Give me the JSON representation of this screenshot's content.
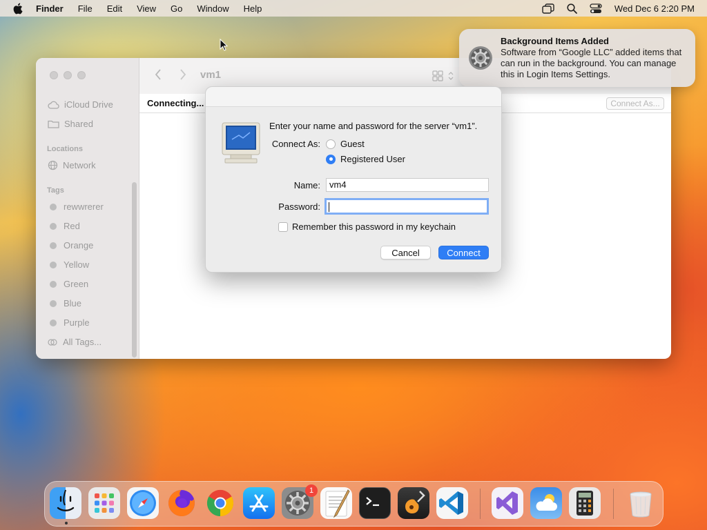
{
  "menubar": {
    "app_name": "Finder",
    "menus": [
      "File",
      "Edit",
      "View",
      "Go",
      "Window",
      "Help"
    ],
    "datetime": "Wed Dec 6  2:20 PM",
    "icons": [
      "apple-icon",
      "screen-mirroring-icon",
      "spotlight-search-icon",
      "control-center-icon"
    ]
  },
  "notification": {
    "title": "Background Items Added",
    "body": "Software from “Google LLC” added items that can run in the background. You can manage this in Login Items Settings.",
    "icon": "system-settings-gear-icon"
  },
  "finder": {
    "title": "vm1",
    "status": "Connecting...",
    "connect_as_button": "Connect As...",
    "sidebar": {
      "icloud": "iCloud Drive",
      "shared": "Shared",
      "locations_header": "Locations",
      "network": "Network",
      "tags_header": "Tags",
      "tags": [
        "rewwrerer",
        "Red",
        "Orange",
        "Yellow",
        "Green",
        "Blue",
        "Purple"
      ],
      "all_tags": "All Tags..."
    }
  },
  "dialog": {
    "prompt": "Enter your name and password for the server “vm1”.",
    "connect_as_label": "Connect As:",
    "guest": "Guest",
    "registered": "Registered User",
    "selected": "Registered User",
    "name_label": "Name:",
    "name_value": "vm4",
    "password_label": "Password:",
    "password_value": "",
    "remember": "Remember this password in my keychain",
    "remember_checked": false,
    "cancel": "Cancel",
    "connect": "Connect"
  },
  "dock": {
    "apps": [
      "Finder",
      "Launchpad",
      "Safari",
      "Firefox",
      "Chrome",
      "App Store",
      "System Settings",
      "TextEdit",
      "Terminal",
      "GarageBand",
      "Visual Studio Code",
      "Visual Studio",
      "Weather",
      "Calculator",
      "Trash"
    ],
    "settings_badge": "1"
  }
}
